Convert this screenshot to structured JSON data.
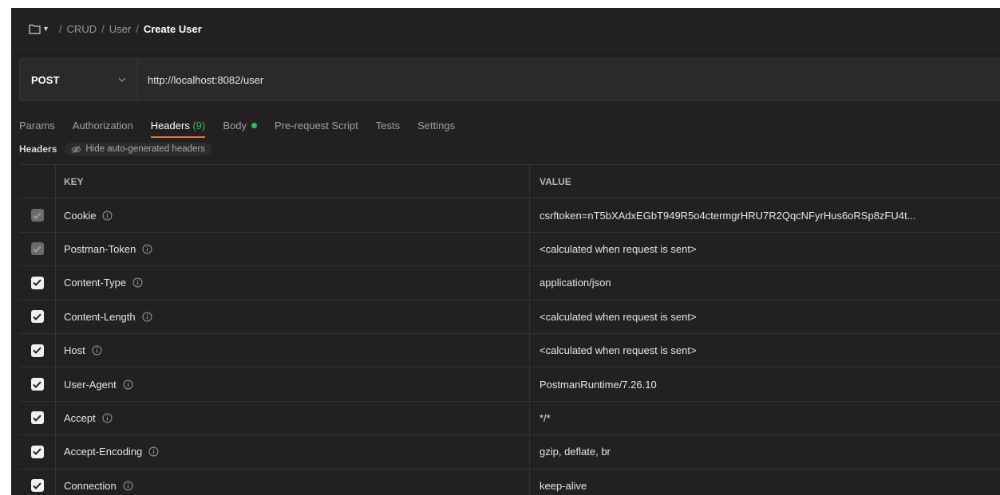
{
  "breadcrumb": {
    "items": [
      "CRUD",
      "User"
    ],
    "current": "Create User"
  },
  "request": {
    "method": "POST",
    "url": "http://localhost:8082/user"
  },
  "tabs": [
    {
      "label": "Params"
    },
    {
      "label": "Authorization"
    },
    {
      "label": "Headers",
      "count": "(9)",
      "active": true
    },
    {
      "label": "Body",
      "dot": true
    },
    {
      "label": "Pre-request Script"
    },
    {
      "label": "Tests"
    },
    {
      "label": "Settings"
    }
  ],
  "subheader": {
    "title": "Headers",
    "hide_label": "Hide auto-generated headers"
  },
  "table": {
    "columns": [
      "KEY",
      "VALUE"
    ],
    "rows": [
      {
        "key": "Cookie",
        "value": "csrftoken=nT5bXAdxEGbT949R5o4ctermgrHRU7R2QqcNFyrHus6oRSp8zFU4t...",
        "checked": true,
        "disabled": true
      },
      {
        "key": "Postman-Token",
        "value": "<calculated when request is sent>",
        "checked": true,
        "disabled": true
      },
      {
        "key": "Content-Type",
        "value": "application/json",
        "checked": true,
        "disabled": false
      },
      {
        "key": "Content-Length",
        "value": "<calculated when request is sent>",
        "checked": true,
        "disabled": false
      },
      {
        "key": "Host",
        "value": "<calculated when request is sent>",
        "checked": true,
        "disabled": false
      },
      {
        "key": "User-Agent",
        "value": "PostmanRuntime/7.26.10",
        "checked": true,
        "disabled": false
      },
      {
        "key": "Accept",
        "value": "*/*",
        "checked": true,
        "disabled": false
      },
      {
        "key": "Accept-Encoding",
        "value": "gzip, deflate, br",
        "checked": true,
        "disabled": false
      },
      {
        "key": "Connection",
        "value": "keep-alive",
        "checked": true,
        "disabled": false
      }
    ]
  },
  "colors": {
    "accent": "#ff6c37",
    "success": "#40b36b",
    "background": "#212121"
  }
}
